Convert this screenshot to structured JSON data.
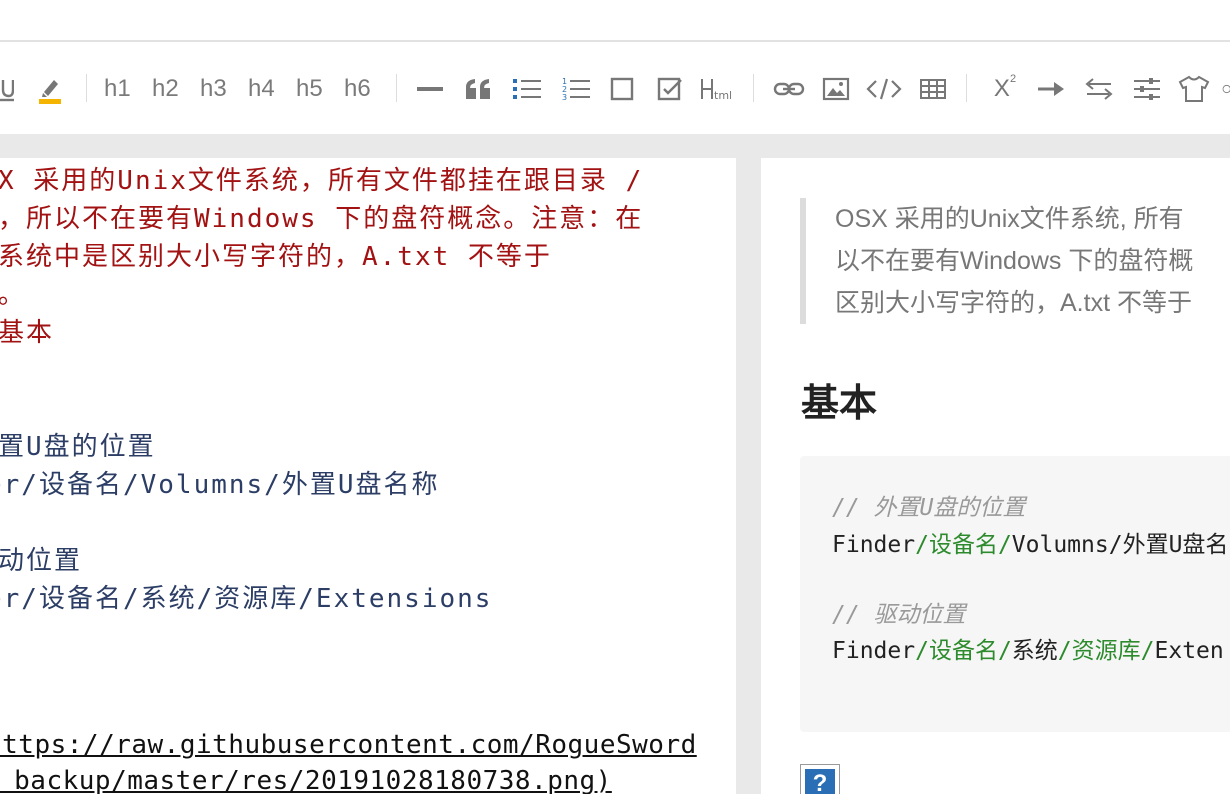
{
  "toolbar": {
    "headings": [
      "h1",
      "h2",
      "h3",
      "h4",
      "h5",
      "h6"
    ],
    "icons": [
      "underline-icon",
      "highlight-icon",
      "horizontal-rule-icon",
      "quote-icon",
      "bullet-list-icon",
      "numbered-list-icon",
      "checkbox-icon",
      "checked-checkbox-icon",
      "html-icon",
      "link-icon",
      "image-icon",
      "code-icon",
      "table-icon",
      "superscript-icon",
      "arrow-right-icon",
      "swap-icon",
      "align-icon",
      "theme-shirt-icon"
    ],
    "html_label": "Html",
    "superscript_label": "X",
    "superscript_small": "2",
    "accent_color": "#f5b400"
  },
  "editor": {
    "lines": [
      "X 采用的Unix文件系统，所有文件都挂在跟目录 /",
      "，所以不在要有Windows 下的盘符概念。注意：在",
      "系统中是区别大小写字符的，A.txt 不等于",
      "。",
      "基本",
      "置U盘的位置",
      "er/设备名/Volumns/外置U盘名称",
      "动位置",
      "er/设备名/系统/资源库/Extensions",
      "https://raw.githubusercontent.com/RogueSword",
      "_backup/master/res/20191028180738.png)"
    ]
  },
  "preview": {
    "quote_lines": [
      "OSX 采用的Unix文件系统, 所有",
      "以不在要有Windows 下的盘符概",
      "区别大小写字符的，A.txt 不等于"
    ],
    "heading": "基本",
    "code": {
      "comment1": "//  外置U盘的位置",
      "line1_a": "Finder",
      "line1_b": "/设备名/",
      "line1_c": "Volumns/外置U盘名",
      "comment2": "//  驱动位置",
      "line2_a": "Finder",
      "line2_b": "/设备名/",
      "line2_c": "系统",
      "line2_d": "/资源库/",
      "line2_e": "Exten"
    },
    "broken_image_label": "?"
  }
}
